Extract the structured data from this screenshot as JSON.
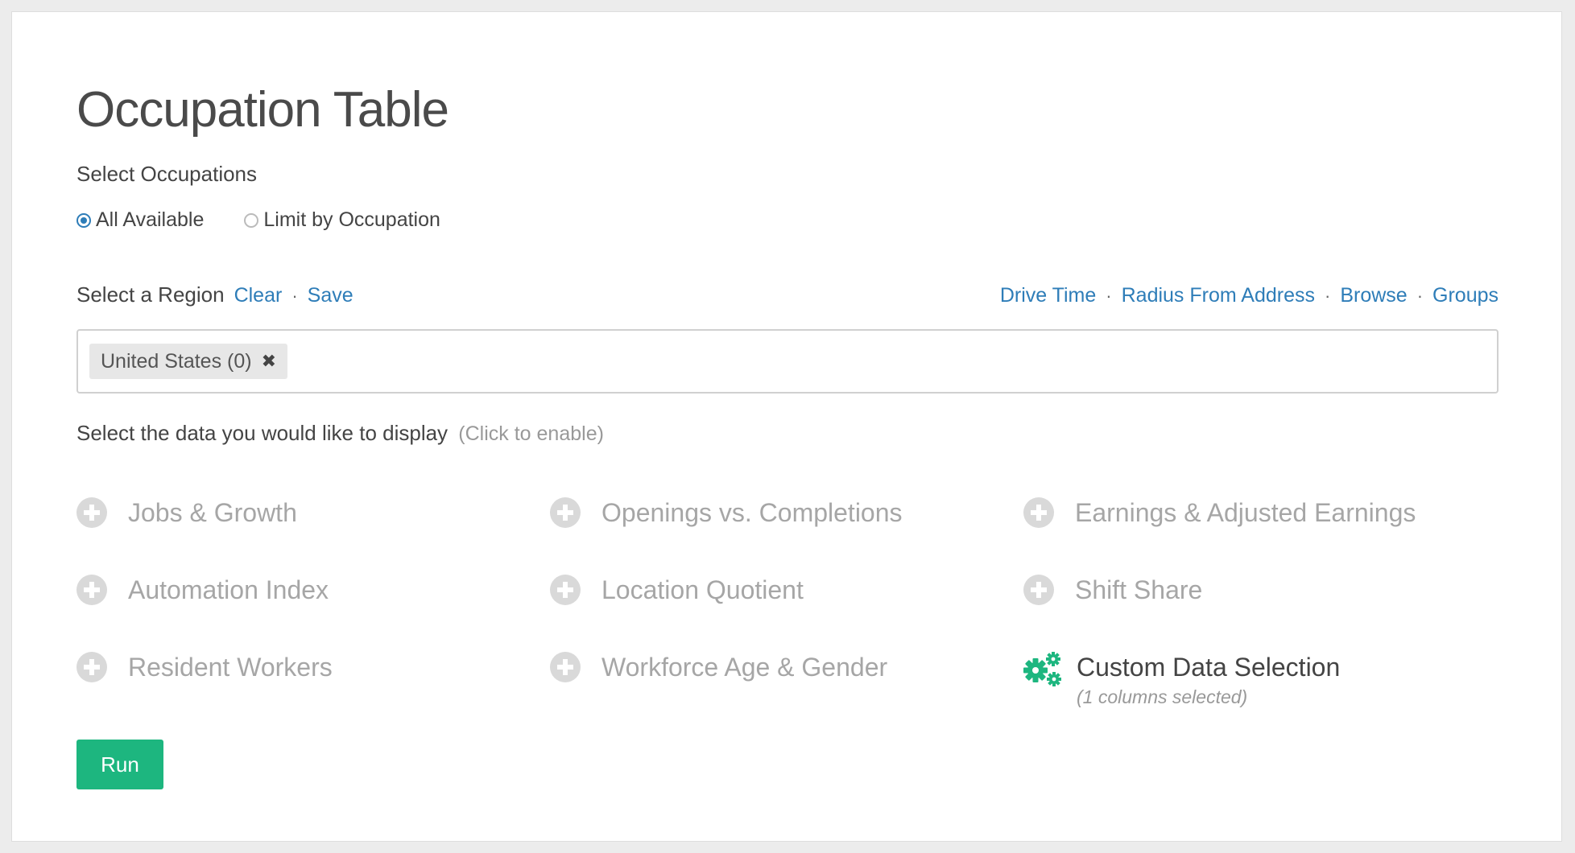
{
  "page": {
    "title": "Occupation Table"
  },
  "occupations": {
    "label": "Select Occupations",
    "options": [
      {
        "label": "All Available",
        "selected": true
      },
      {
        "label": "Limit by Occupation",
        "selected": false
      }
    ]
  },
  "region": {
    "label": "Select a Region",
    "clear_label": "Clear",
    "save_label": "Save",
    "right_links": [
      "Drive Time",
      "Radius From Address",
      "Browse",
      "Groups"
    ],
    "selected_chip": "United States (0)"
  },
  "display": {
    "label": "Select the data you would like to display",
    "hint": "(Click to enable)",
    "options": [
      {
        "label": "Jobs & Growth",
        "enabled": false
      },
      {
        "label": "Openings vs. Completions",
        "enabled": false
      },
      {
        "label": "Earnings & Adjusted Earnings",
        "enabled": false
      },
      {
        "label": "Automation Index",
        "enabled": false
      },
      {
        "label": "Location Quotient",
        "enabled": false
      },
      {
        "label": "Shift Share",
        "enabled": false
      },
      {
        "label": "Resident Workers",
        "enabled": false
      },
      {
        "label": "Workforce Age & Gender",
        "enabled": false
      },
      {
        "label": "Custom Data Selection",
        "enabled": true,
        "sub": "(1 columns selected)"
      }
    ]
  },
  "run_label": "Run",
  "colors": {
    "link": "#2e7db8",
    "accent_green": "#1db67f",
    "disabled_text": "#a6a6a6"
  },
  "icons": {
    "option_disabled": "plus-circle-icon",
    "option_enabled": "gears-icon",
    "chip_remove": "close-icon"
  }
}
